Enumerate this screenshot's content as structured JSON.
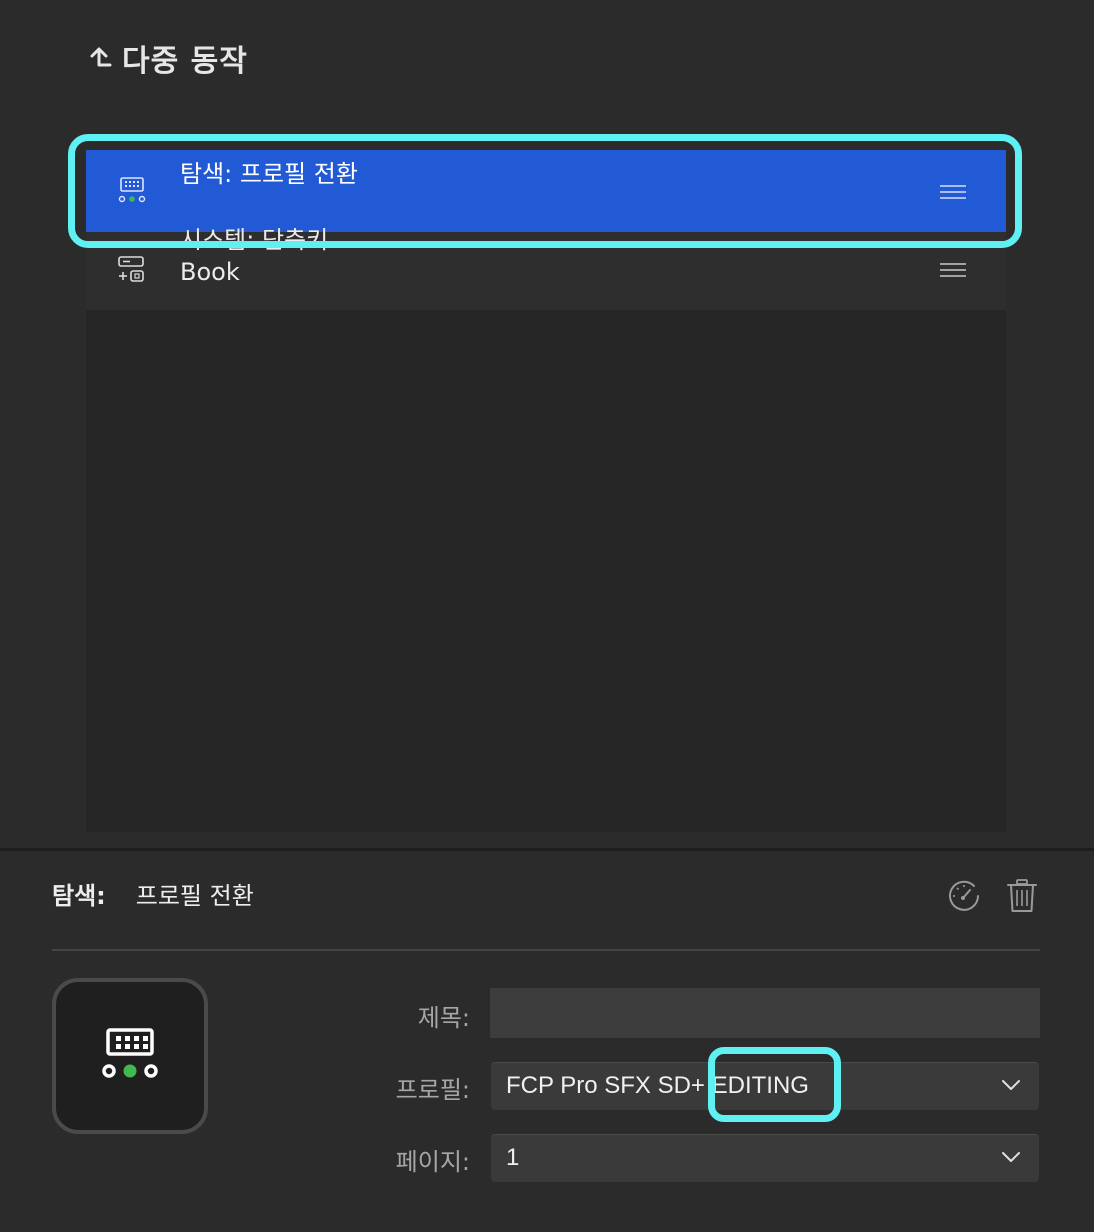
{
  "header": {
    "back_icon": "return-up-arrow-icon",
    "title": "다중 동작"
  },
  "actions": [
    {
      "icon": "keypad-profile-icon",
      "line1": "탐색: 프로필 전환",
      "line2": "",
      "selected": true
    },
    {
      "icon": "shortcut-key-icon",
      "line1": "시스템: 단축키",
      "line2": "Book",
      "selected": false
    }
  ],
  "detail": {
    "category": "탐색:",
    "name": "프로필 전환",
    "speed_icon": "gauge-icon",
    "delete_icon": "trash-icon"
  },
  "form": {
    "title_label": "제목:",
    "title_value": "",
    "profile_label": "프로필:",
    "profile_value": "FCP Pro SFX SD+ EDITING",
    "page_label": "페이지:",
    "page_value": "1"
  },
  "colors": {
    "selection": "#2259d4",
    "highlight": "#5ff0f4",
    "green_dot": "#3fb950"
  }
}
